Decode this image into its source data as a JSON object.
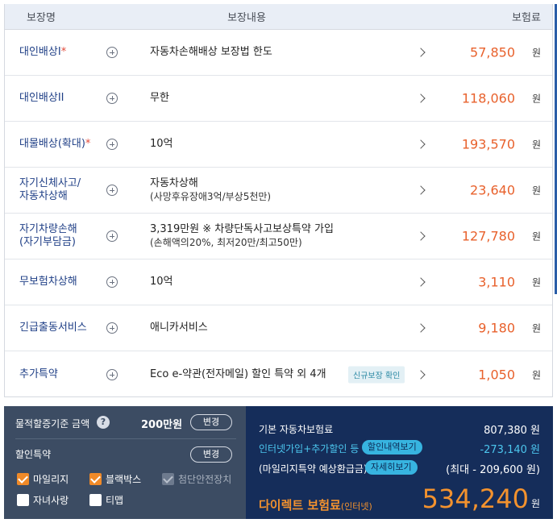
{
  "header": {
    "name": "보장명",
    "content": "보장내용",
    "premium": "보험료"
  },
  "rows": [
    {
      "name": "대인배상I",
      "star": "*",
      "desc": "자동차손해배상 보장법 한도",
      "sub": "",
      "badge": "",
      "premium": "57,850",
      "unit": "원"
    },
    {
      "name": "대인배상II",
      "star": "",
      "desc": "무한",
      "sub": "",
      "badge": "",
      "premium": "118,060",
      "unit": "원"
    },
    {
      "name": "대물배상(확대)",
      "star": "*",
      "desc": "10억",
      "sub": "",
      "badge": "",
      "premium": "193,570",
      "unit": "원"
    },
    {
      "name": "자기신체사고/",
      "name2": "자동차상해",
      "star": "",
      "desc": "자동차상해",
      "sub": "(사망후유장애3억/부상5천만)",
      "badge": "",
      "premium": "23,640",
      "unit": "원"
    },
    {
      "name": "자기차량손해",
      "name2": "(자기부담금)",
      "star": "",
      "desc": "3,319만원 ※ 차량단독사고보상특약 가입",
      "sub": "(손해액의20%, 최저20만/최고50만)",
      "badge": "",
      "premium": "127,780",
      "unit": "원"
    },
    {
      "name": "무보험차상해",
      "star": "",
      "desc": "10억",
      "sub": "",
      "badge": "",
      "premium": "3,110",
      "unit": "원"
    },
    {
      "name": "긴급출동서비스",
      "star": "",
      "desc": "애니카서비스",
      "sub": "",
      "badge": "",
      "premium": "9,180",
      "unit": "원"
    },
    {
      "name": "추가특약",
      "star": "",
      "desc": "Eco e-약관(전자메일) 할인 특약 외 4개",
      "sub": "",
      "badge": "신규보장 확인",
      "premium": "1,050",
      "unit": "원"
    }
  ],
  "left_panel": {
    "threshold_label": "물적할증기준 금액",
    "help_icon": "?",
    "threshold_value": "200만원",
    "change_label": "변경",
    "discount_label": "할인특약",
    "change_label2": "변경",
    "options": [
      {
        "label": "마일리지",
        "state": "checked"
      },
      {
        "label": "블랙박스",
        "state": "checked"
      },
      {
        "label": "첨단안전장치",
        "state": "disabled"
      },
      {
        "label": "자녀사랑",
        "state": "unchecked"
      },
      {
        "label": "티맵",
        "state": "unchecked"
      }
    ]
  },
  "right_panel": {
    "base_label": "기본 자동차보험료",
    "base_value": "807,380 원",
    "discount_label": "인터넷가입+추가할인 등",
    "discount_tag": "할인내역보기",
    "discount_value": "-273,140 원",
    "refund_label": "(마일리지특약 예상환급금)",
    "refund_tag": "자세히보기",
    "refund_value": "(최대 - 209,600 원)",
    "final_label": "다이렉트 보험료",
    "final_sub": "(인터넷)",
    "final_value": "534,240",
    "final_unit": "원"
  },
  "colors": {
    "accent": "#e8612c",
    "navy": "#152d5a",
    "slate": "#3c4c63",
    "cyan": "#4cc6ee"
  }
}
